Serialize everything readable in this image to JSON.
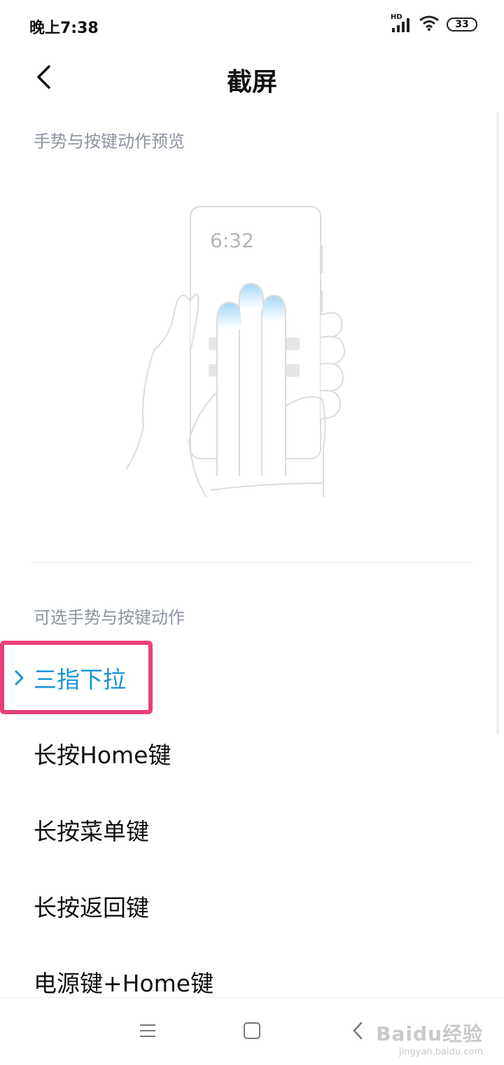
{
  "status_bar": {
    "time": "晚上7:38",
    "network_label": "HD",
    "battery_level": "33",
    "icons": [
      "signal-icon",
      "wifi-icon",
      "battery-icon"
    ]
  },
  "header": {
    "title": "截屏",
    "back_icon": "chevron-left-icon"
  },
  "preview": {
    "section_title": "手势与按键动作预览",
    "phone_clock": "6:32"
  },
  "options": {
    "section_title": "可选手势与按键动作",
    "items": [
      {
        "label": "三指下拉",
        "selected": true
      },
      {
        "label": "长按Home键",
        "selected": false
      },
      {
        "label": "长按菜单键",
        "selected": false
      },
      {
        "label": "长按返回键",
        "selected": false
      },
      {
        "label": "电源键+Home键",
        "selected": false
      }
    ]
  },
  "nav_bar": {
    "icons": [
      "menu-icon",
      "home-icon",
      "back-icon"
    ]
  },
  "watermark": {
    "main": "Baidu经验",
    "sub": "jingyan.baidu.com"
  },
  "colors": {
    "accent": "#1794d6",
    "highlight": "#e8407a",
    "section_title": "#8c93a0"
  }
}
